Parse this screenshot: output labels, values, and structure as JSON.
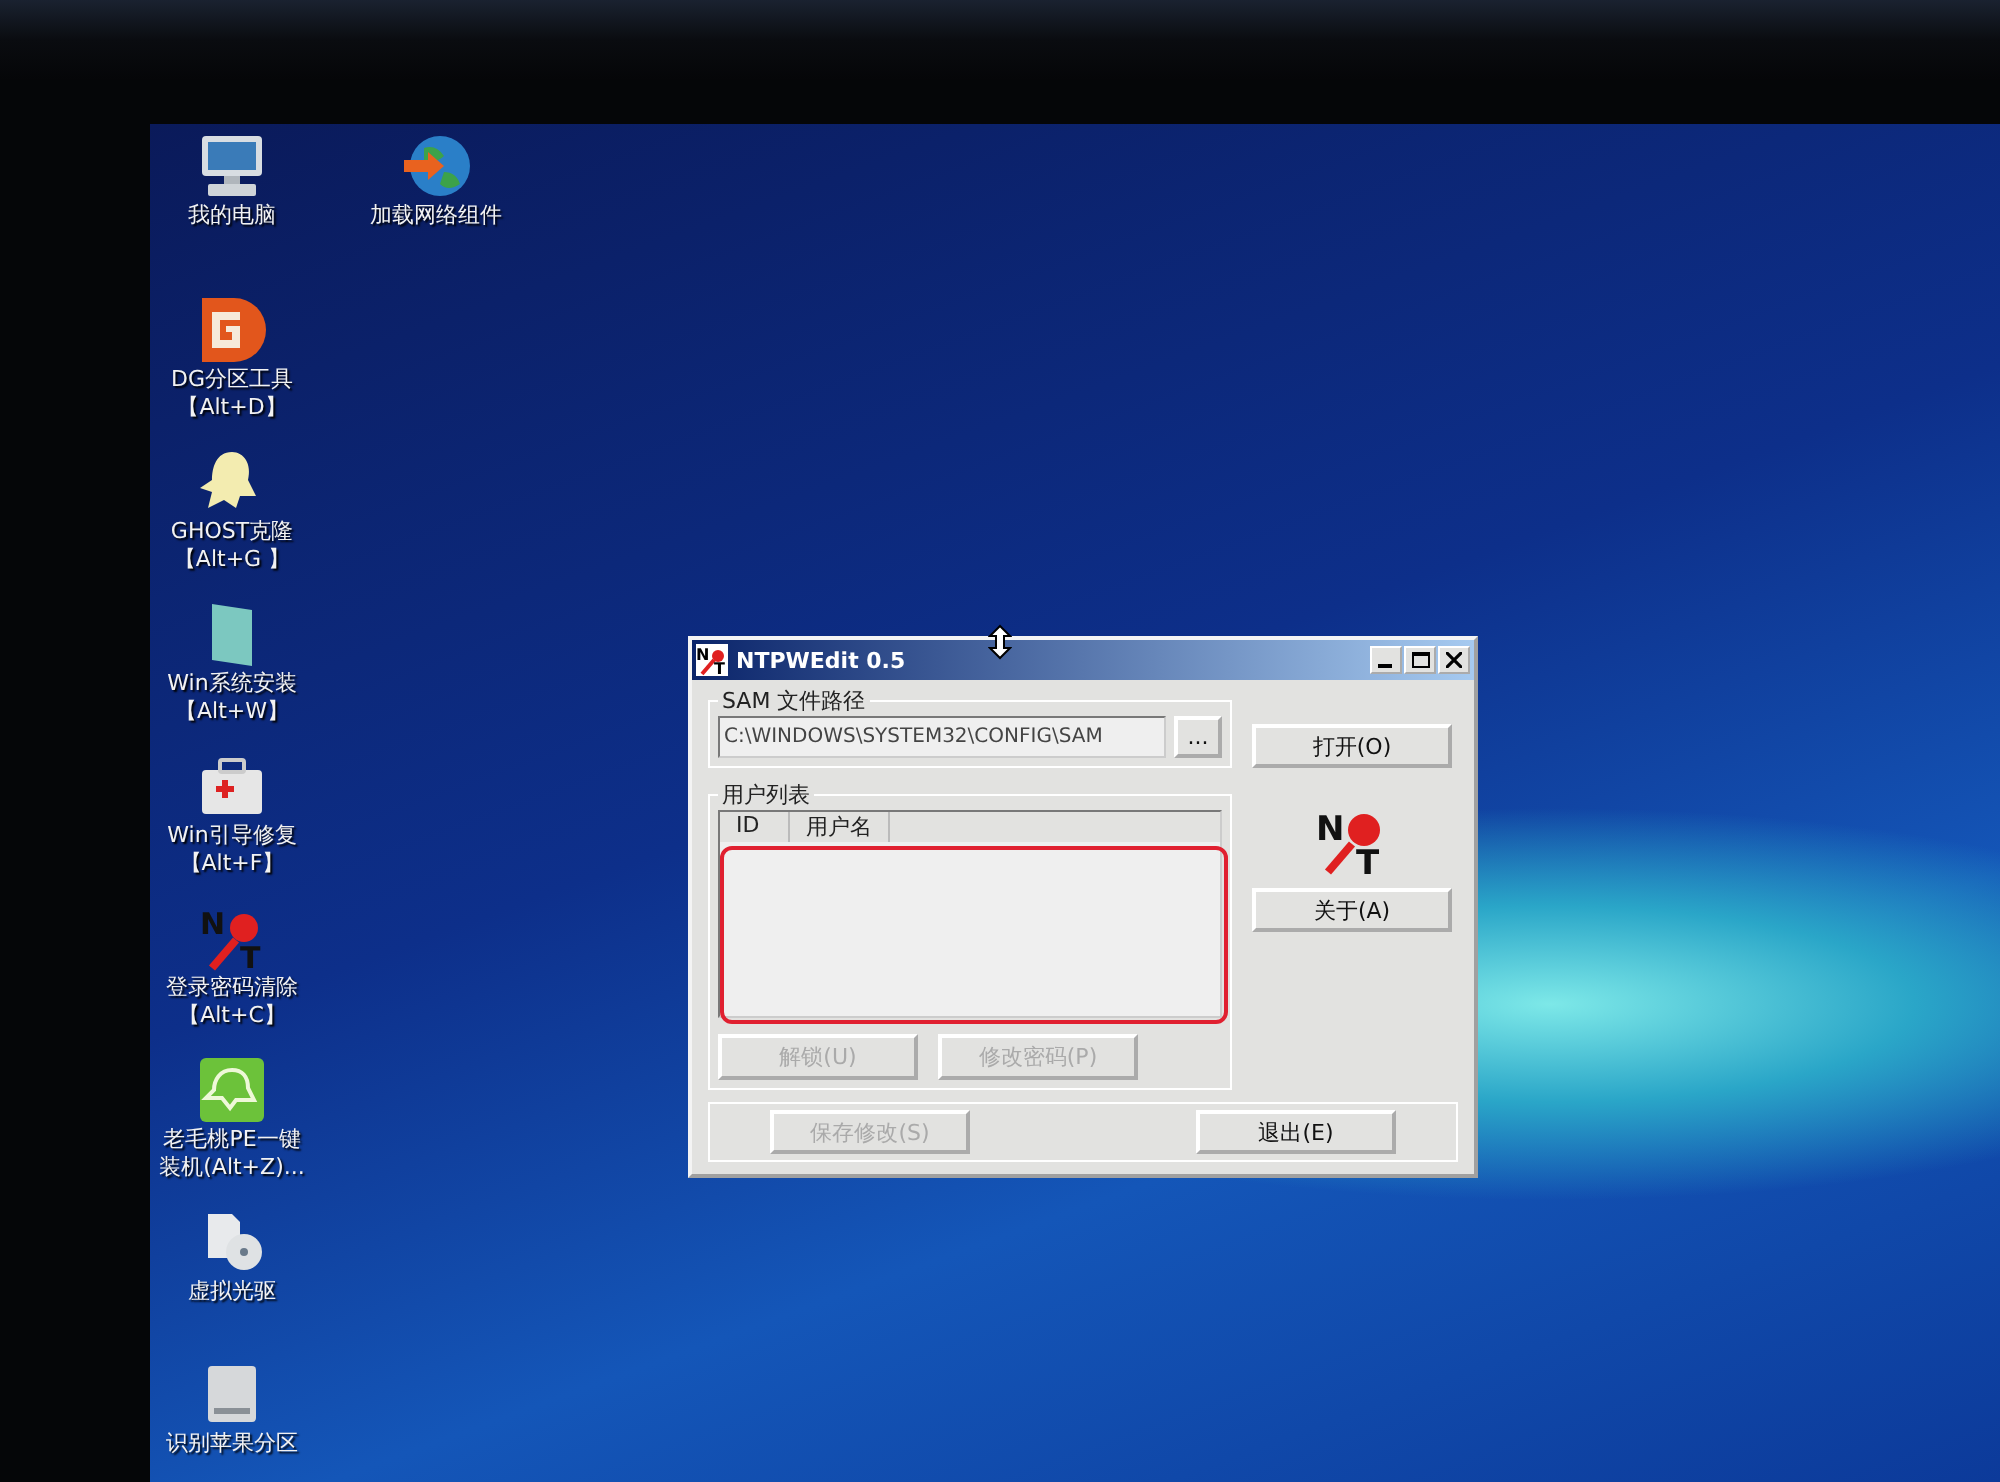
{
  "desktop": {
    "top_row": [
      {
        "kind": "computer",
        "lines": [
          "我的电脑"
        ]
      },
      {
        "kind": "globe",
        "lines": [
          "加载网络组件"
        ]
      }
    ],
    "column": [
      {
        "kind": "dg",
        "lines": [
          "DG分区工具",
          "【Alt+D】"
        ]
      },
      {
        "kind": "ghost",
        "lines": [
          "GHOST克隆",
          "【Alt+G 】"
        ]
      },
      {
        "kind": "install",
        "lines": [
          "Win系统安装",
          "【Alt+W】"
        ]
      },
      {
        "kind": "repair",
        "lines": [
          "Win引导修复",
          "【Alt+F】"
        ]
      },
      {
        "kind": "ntkey",
        "letters": [
          "N",
          "T"
        ],
        "lines": [
          "登录密码清除",
          "【Alt+C】"
        ]
      },
      {
        "kind": "peach",
        "lines": [
          "老毛桃PE一键",
          "装机(Alt+Z)..."
        ]
      },
      {
        "kind": "cdrom",
        "lines": [
          "虚拟光驱"
        ]
      },
      {
        "kind": "disk",
        "lines": [
          "识别苹果分区"
        ]
      }
    ]
  },
  "window": {
    "title": "NTPWEdit 0.5",
    "icon_letters": [
      "N",
      "T"
    ],
    "sam_group": {
      "label": "SAM 文件路径",
      "path": "C:\\WINDOWS\\SYSTEM32\\CONFIG\\SAM",
      "browse": "...",
      "open": "打开(O)"
    },
    "user_group": {
      "label": "用户列表",
      "columns": [
        "ID",
        "用户名"
      ],
      "highlighted": true,
      "buttons": [
        {
          "label": "解锁(U)",
          "disabled": true
        },
        {
          "label": "修改密码(P)",
          "disabled": true
        }
      ]
    },
    "logo_letters": [
      "N",
      "T"
    ],
    "about": "关于(A)",
    "footer_buttons": [
      {
        "label": "保存修改(S)",
        "disabled": true
      },
      {
        "label": "退出(E)",
        "disabled": false
      }
    ]
  }
}
